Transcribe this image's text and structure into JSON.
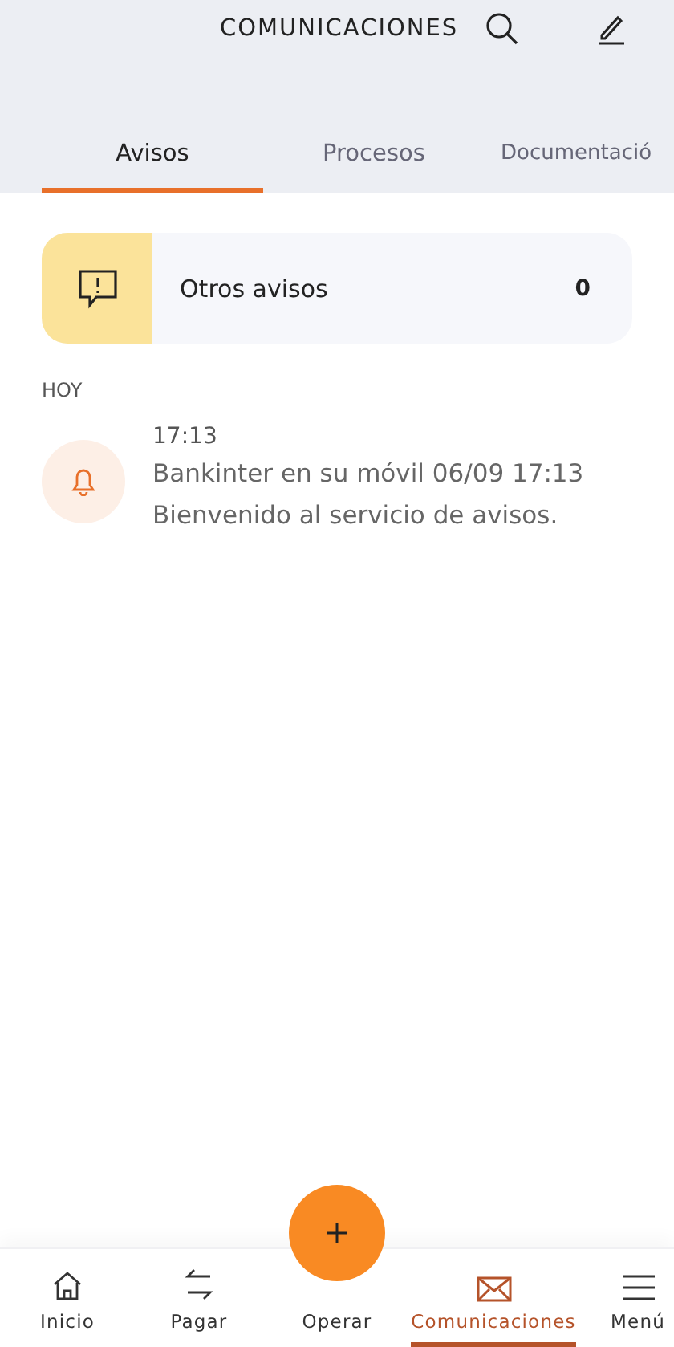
{
  "header": {
    "title": "COMUNICACIONES"
  },
  "tabs": [
    {
      "label": "Avisos",
      "selected": true
    },
    {
      "label": "Procesos",
      "selected": false
    },
    {
      "label": "Documentació",
      "selected": false
    }
  ],
  "summary_card": {
    "label": "Otros avisos",
    "count": "0"
  },
  "section_label": "HOY",
  "notices": [
    {
      "time": "17:13",
      "title": "Bankinter en su móvil 06/09 17:13",
      "message": "Bienvenido al servicio de avisos."
    }
  ],
  "bottom_nav": [
    {
      "kind": "home",
      "label": "Inicio",
      "selected": false
    },
    {
      "kind": "transfer",
      "label": "Pagar",
      "selected": false
    },
    {
      "kind": "operate",
      "label": "Operar",
      "selected": false
    },
    {
      "kind": "mail",
      "label": "Comunicaciones",
      "selected": true
    },
    {
      "kind": "menu",
      "label": "Menú",
      "selected": false
    }
  ]
}
